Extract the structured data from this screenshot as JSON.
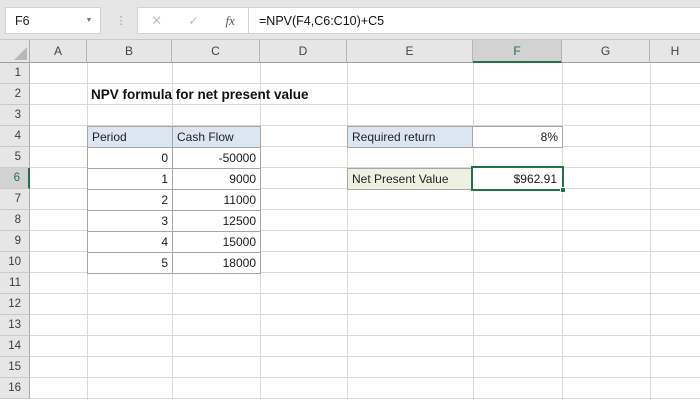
{
  "formula_bar": {
    "name_box_value": "F6",
    "dropdown_icon": "▼",
    "dots_icon": "⋮",
    "cancel_icon": "✕",
    "enter_icon": "✓",
    "fx_icon": "fx",
    "formula": "=NPV(F4,C6:C10)+C5"
  },
  "grid": {
    "selected_cell": "F6",
    "selected_column": "F",
    "selected_row": "6",
    "column_headers": [
      "A",
      "B",
      "C",
      "D",
      "E",
      "F",
      "G",
      "H"
    ],
    "row_headers": [
      "1",
      "2",
      "3",
      "4",
      "5",
      "6",
      "7",
      "8",
      "9",
      "10",
      "11",
      "12",
      "13",
      "14",
      "15",
      "16"
    ]
  },
  "sheet": {
    "title": "NPV formula for net present value",
    "table": {
      "headers": [
        "Period",
        "Cash Flow"
      ],
      "rows": [
        [
          "0",
          "-50000"
        ],
        [
          "1",
          "9000"
        ],
        [
          "2",
          "11000"
        ],
        [
          "3",
          "12500"
        ],
        [
          "4",
          "15000"
        ],
        [
          "5",
          "18000"
        ]
      ]
    },
    "required_return_label": "Required return",
    "required_return_value": "8%",
    "npv_label": "Net Present Value",
    "npv_value": "$962.91"
  },
  "colors": {
    "excel_green": "#217346",
    "header_fill": "#E6E6E6",
    "selected_header_fill": "#D2D2D2",
    "table_header_fill": "#DCE6F1",
    "npv_label_fill": "#EEF0E2",
    "gridline": "#D9D9D9",
    "cell_border": "#A6A6A6"
  }
}
